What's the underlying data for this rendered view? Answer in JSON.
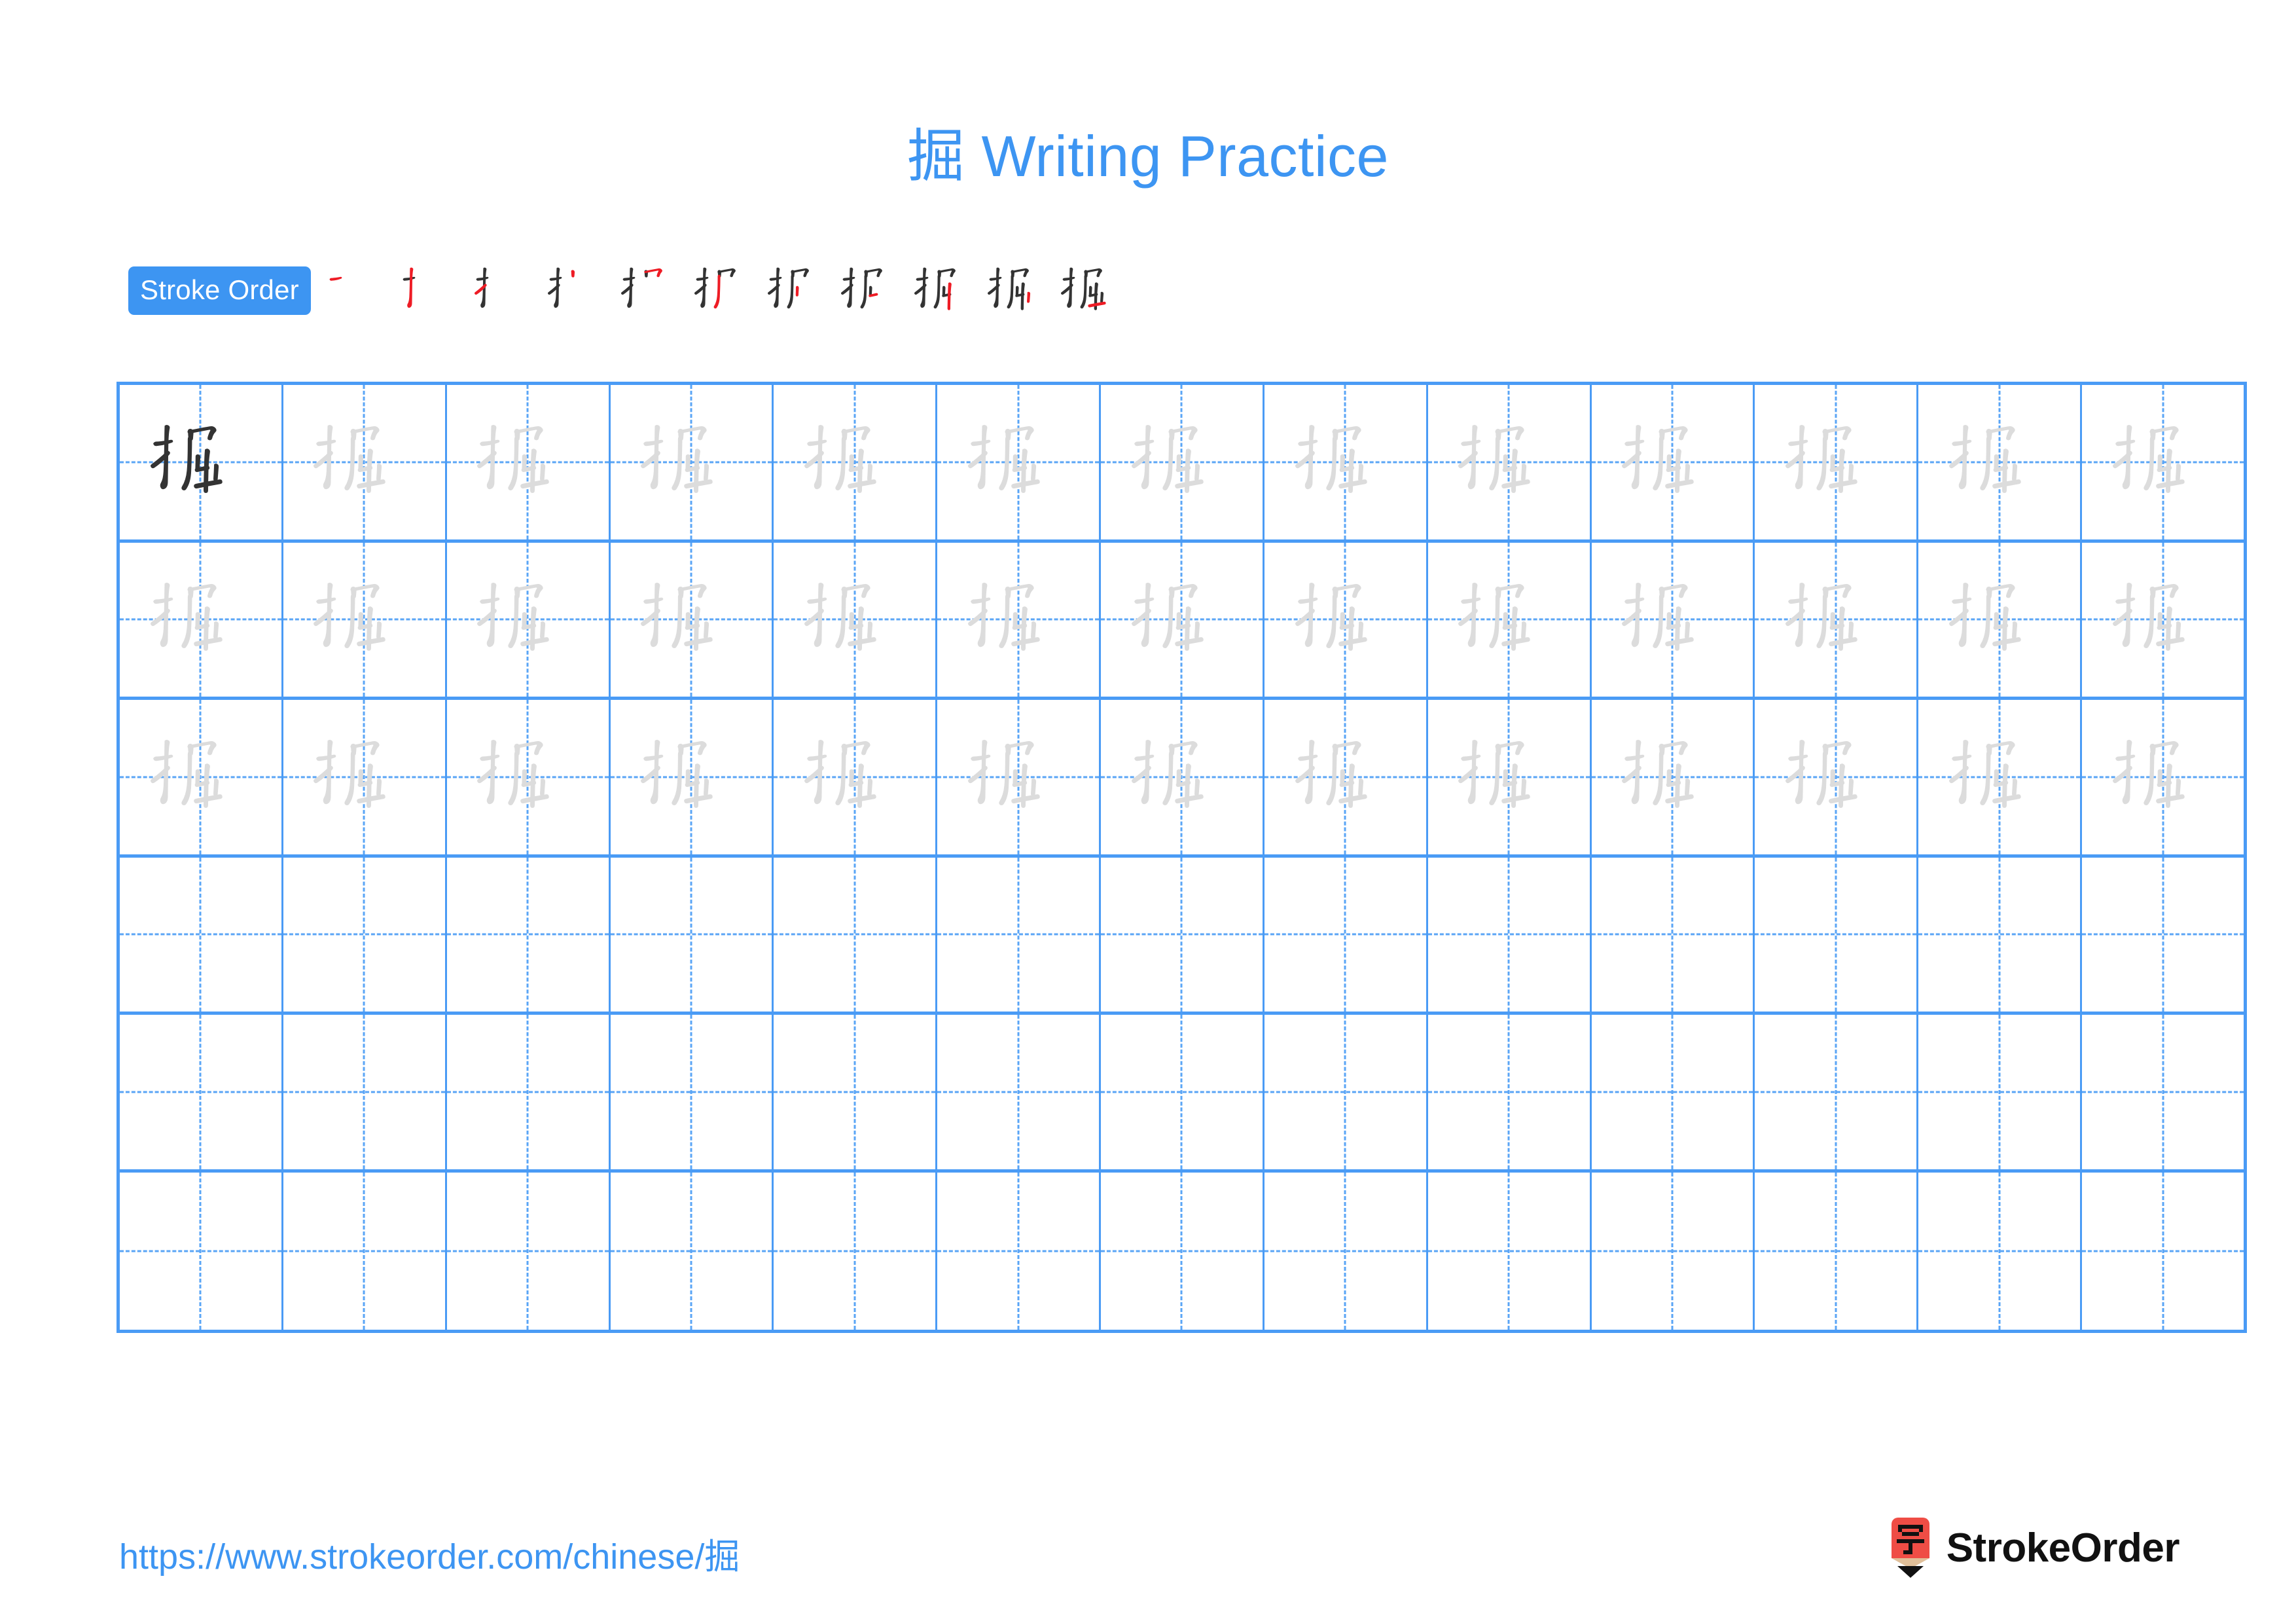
{
  "header": {
    "character": "掘",
    "title_suffix": " Writing Practice",
    "title_color": "#3d95f2"
  },
  "stroke_order": {
    "badge_label": "Stroke Order",
    "badge_bg": "#3d95f2",
    "badge_text_color": "#ffffff",
    "existing_stroke_color": "#333333",
    "new_stroke_color": "#ee1c25",
    "step_count": 11,
    "steps": [
      {
        "index": 1,
        "strokes_shown": 1,
        "new_stroke": 1
      },
      {
        "index": 2,
        "strokes_shown": 2,
        "new_stroke": 2
      },
      {
        "index": 3,
        "strokes_shown": 3,
        "new_stroke": 3
      },
      {
        "index": 4,
        "strokes_shown": 4,
        "new_stroke": 4
      },
      {
        "index": 5,
        "strokes_shown": 5,
        "new_stroke": 5
      },
      {
        "index": 6,
        "strokes_shown": 6,
        "new_stroke": 6
      },
      {
        "index": 7,
        "strokes_shown": 7,
        "new_stroke": 7
      },
      {
        "index": 8,
        "strokes_shown": 8,
        "new_stroke": 8
      },
      {
        "index": 9,
        "strokes_shown": 9,
        "new_stroke": 9
      },
      {
        "index": 10,
        "strokes_shown": 10,
        "new_stroke": 10
      },
      {
        "index": 11,
        "strokes_shown": 11,
        "new_stroke": 11
      }
    ]
  },
  "practice_grid": {
    "columns": 13,
    "rows": 6,
    "grid_line_color": "#4a9bf5",
    "guide_line_color": "#5aa5f6",
    "model_char_color": "#333333",
    "trace_char_color": "#dcdcdc",
    "character": "掘",
    "row_fill": [
      {
        "row": 1,
        "model_cells": 1,
        "trace_cells": 12,
        "empty_cells": 0
      },
      {
        "row": 2,
        "model_cells": 0,
        "trace_cells": 13,
        "empty_cells": 0
      },
      {
        "row": 3,
        "model_cells": 0,
        "trace_cells": 13,
        "empty_cells": 0
      },
      {
        "row": 4,
        "model_cells": 0,
        "trace_cells": 0,
        "empty_cells": 13
      },
      {
        "row": 5,
        "model_cells": 0,
        "trace_cells": 0,
        "empty_cells": 13
      },
      {
        "row": 6,
        "model_cells": 0,
        "trace_cells": 0,
        "empty_cells": 13
      }
    ]
  },
  "footer": {
    "url": "https://www.strokeorder.com/chinese/掘",
    "url_color": "#3d95f2",
    "brand_name": "StrokeOrder",
    "brand_icon_char": "字",
    "brand_icon_color": "#ef4d45",
    "brand_icon_wood_color": "#e0bf99",
    "brand_icon_tip_color": "#111111",
    "brand_text_color": "#111111"
  }
}
